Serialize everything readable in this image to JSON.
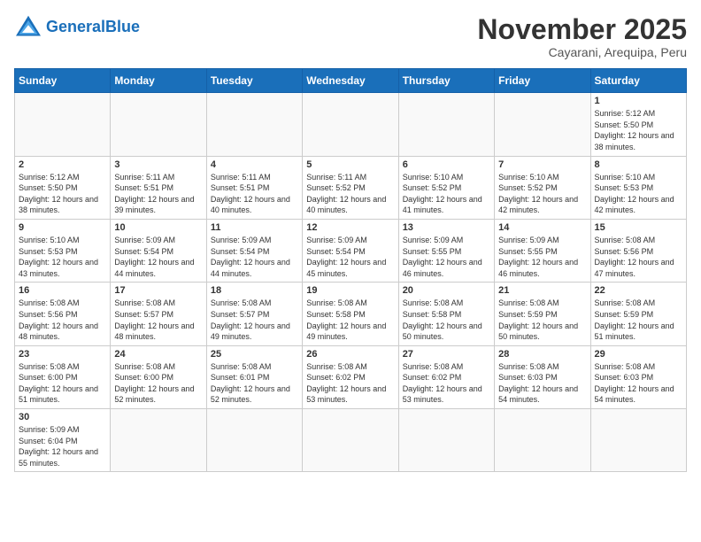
{
  "header": {
    "logo_general": "General",
    "logo_blue": "Blue",
    "month_title": "November 2025",
    "location": "Cayarani, Arequipa, Peru"
  },
  "weekdays": [
    "Sunday",
    "Monday",
    "Tuesday",
    "Wednesday",
    "Thursday",
    "Friday",
    "Saturday"
  ],
  "weeks": [
    [
      {
        "day": "",
        "info": ""
      },
      {
        "day": "",
        "info": ""
      },
      {
        "day": "",
        "info": ""
      },
      {
        "day": "",
        "info": ""
      },
      {
        "day": "",
        "info": ""
      },
      {
        "day": "",
        "info": ""
      },
      {
        "day": "1",
        "info": "Sunrise: 5:12 AM\nSunset: 5:50 PM\nDaylight: 12 hours and 38 minutes."
      }
    ],
    [
      {
        "day": "2",
        "info": "Sunrise: 5:12 AM\nSunset: 5:50 PM\nDaylight: 12 hours and 38 minutes."
      },
      {
        "day": "3",
        "info": "Sunrise: 5:11 AM\nSunset: 5:51 PM\nDaylight: 12 hours and 39 minutes."
      },
      {
        "day": "4",
        "info": "Sunrise: 5:11 AM\nSunset: 5:51 PM\nDaylight: 12 hours and 40 minutes."
      },
      {
        "day": "5",
        "info": "Sunrise: 5:11 AM\nSunset: 5:52 PM\nDaylight: 12 hours and 40 minutes."
      },
      {
        "day": "6",
        "info": "Sunrise: 5:10 AM\nSunset: 5:52 PM\nDaylight: 12 hours and 41 minutes."
      },
      {
        "day": "7",
        "info": "Sunrise: 5:10 AM\nSunset: 5:52 PM\nDaylight: 12 hours and 42 minutes."
      },
      {
        "day": "8",
        "info": "Sunrise: 5:10 AM\nSunset: 5:53 PM\nDaylight: 12 hours and 42 minutes."
      }
    ],
    [
      {
        "day": "9",
        "info": "Sunrise: 5:10 AM\nSunset: 5:53 PM\nDaylight: 12 hours and 43 minutes."
      },
      {
        "day": "10",
        "info": "Sunrise: 5:09 AM\nSunset: 5:54 PM\nDaylight: 12 hours and 44 minutes."
      },
      {
        "day": "11",
        "info": "Sunrise: 5:09 AM\nSunset: 5:54 PM\nDaylight: 12 hours and 44 minutes."
      },
      {
        "day": "12",
        "info": "Sunrise: 5:09 AM\nSunset: 5:54 PM\nDaylight: 12 hours and 45 minutes."
      },
      {
        "day": "13",
        "info": "Sunrise: 5:09 AM\nSunset: 5:55 PM\nDaylight: 12 hours and 46 minutes."
      },
      {
        "day": "14",
        "info": "Sunrise: 5:09 AM\nSunset: 5:55 PM\nDaylight: 12 hours and 46 minutes."
      },
      {
        "day": "15",
        "info": "Sunrise: 5:08 AM\nSunset: 5:56 PM\nDaylight: 12 hours and 47 minutes."
      }
    ],
    [
      {
        "day": "16",
        "info": "Sunrise: 5:08 AM\nSunset: 5:56 PM\nDaylight: 12 hours and 48 minutes."
      },
      {
        "day": "17",
        "info": "Sunrise: 5:08 AM\nSunset: 5:57 PM\nDaylight: 12 hours and 48 minutes."
      },
      {
        "day": "18",
        "info": "Sunrise: 5:08 AM\nSunset: 5:57 PM\nDaylight: 12 hours and 49 minutes."
      },
      {
        "day": "19",
        "info": "Sunrise: 5:08 AM\nSunset: 5:58 PM\nDaylight: 12 hours and 49 minutes."
      },
      {
        "day": "20",
        "info": "Sunrise: 5:08 AM\nSunset: 5:58 PM\nDaylight: 12 hours and 50 minutes."
      },
      {
        "day": "21",
        "info": "Sunrise: 5:08 AM\nSunset: 5:59 PM\nDaylight: 12 hours and 50 minutes."
      },
      {
        "day": "22",
        "info": "Sunrise: 5:08 AM\nSunset: 5:59 PM\nDaylight: 12 hours and 51 minutes."
      }
    ],
    [
      {
        "day": "23",
        "info": "Sunrise: 5:08 AM\nSunset: 6:00 PM\nDaylight: 12 hours and 51 minutes."
      },
      {
        "day": "24",
        "info": "Sunrise: 5:08 AM\nSunset: 6:00 PM\nDaylight: 12 hours and 52 minutes."
      },
      {
        "day": "25",
        "info": "Sunrise: 5:08 AM\nSunset: 6:01 PM\nDaylight: 12 hours and 52 minutes."
      },
      {
        "day": "26",
        "info": "Sunrise: 5:08 AM\nSunset: 6:02 PM\nDaylight: 12 hours and 53 minutes."
      },
      {
        "day": "27",
        "info": "Sunrise: 5:08 AM\nSunset: 6:02 PM\nDaylight: 12 hours and 53 minutes."
      },
      {
        "day": "28",
        "info": "Sunrise: 5:08 AM\nSunset: 6:03 PM\nDaylight: 12 hours and 54 minutes."
      },
      {
        "day": "29",
        "info": "Sunrise: 5:08 AM\nSunset: 6:03 PM\nDaylight: 12 hours and 54 minutes."
      }
    ],
    [
      {
        "day": "30",
        "info": "Sunrise: 5:09 AM\nSunset: 6:04 PM\nDaylight: 12 hours and 55 minutes."
      },
      {
        "day": "",
        "info": ""
      },
      {
        "day": "",
        "info": ""
      },
      {
        "day": "",
        "info": ""
      },
      {
        "day": "",
        "info": ""
      },
      {
        "day": "",
        "info": ""
      },
      {
        "day": "",
        "info": ""
      }
    ]
  ]
}
